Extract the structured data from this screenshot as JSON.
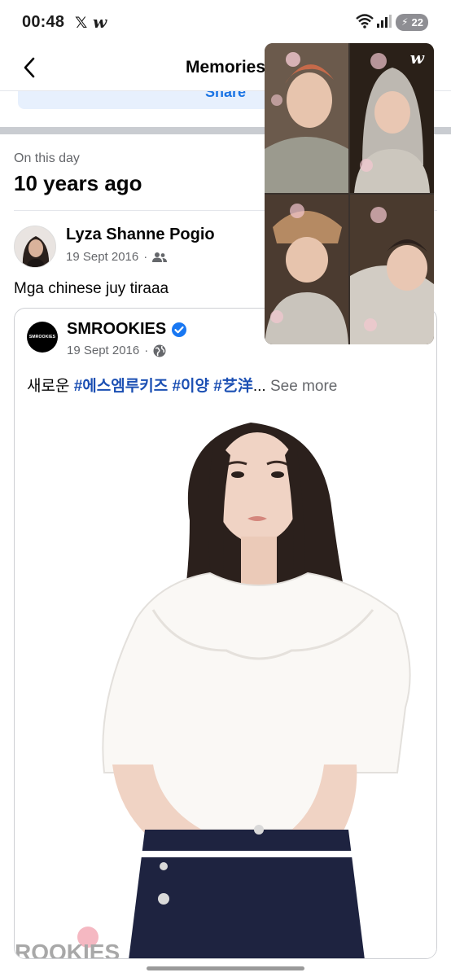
{
  "status_bar": {
    "time": "00:48",
    "x_icon": "x-logo-icon",
    "w_icon": "weverse-icon",
    "battery_level": "22",
    "wifi_icon": "wifi-icon",
    "signal_icon": "signal-icon"
  },
  "header": {
    "title": "Memories",
    "back_icon": "chevron-left-icon",
    "more_icon": "more-icon"
  },
  "share_button": {
    "label": "Share"
  },
  "memory": {
    "label": "On this day",
    "time_ago": "10 years ago"
  },
  "post": {
    "author": "Lyza Shanne Pogio",
    "date": "19 Sept 2016",
    "separator": "·",
    "audience_icon": "friends-icon",
    "text": "Mga chinese juy tiraaa",
    "shared": {
      "page_name": "SMROOKIES",
      "logo_text": "SMROOKIES",
      "verified": true,
      "date": "19 Sept 2016",
      "separator": "·",
      "audience_icon": "globe-icon",
      "caption_pre": "새로운 ",
      "caption_tags": "#에스엠루키즈 #이양 #艺洋",
      "caption_ellipsis": "...",
      "see_more": " See more"
    }
  },
  "video_overlay": {
    "app_icon": "weverse-icon",
    "w_glyph": "w"
  },
  "colors": {
    "link_blue": "#1b74e4",
    "hashtag": "#1b4fb3",
    "muted": "#65676b",
    "verified": "#1877f2"
  }
}
